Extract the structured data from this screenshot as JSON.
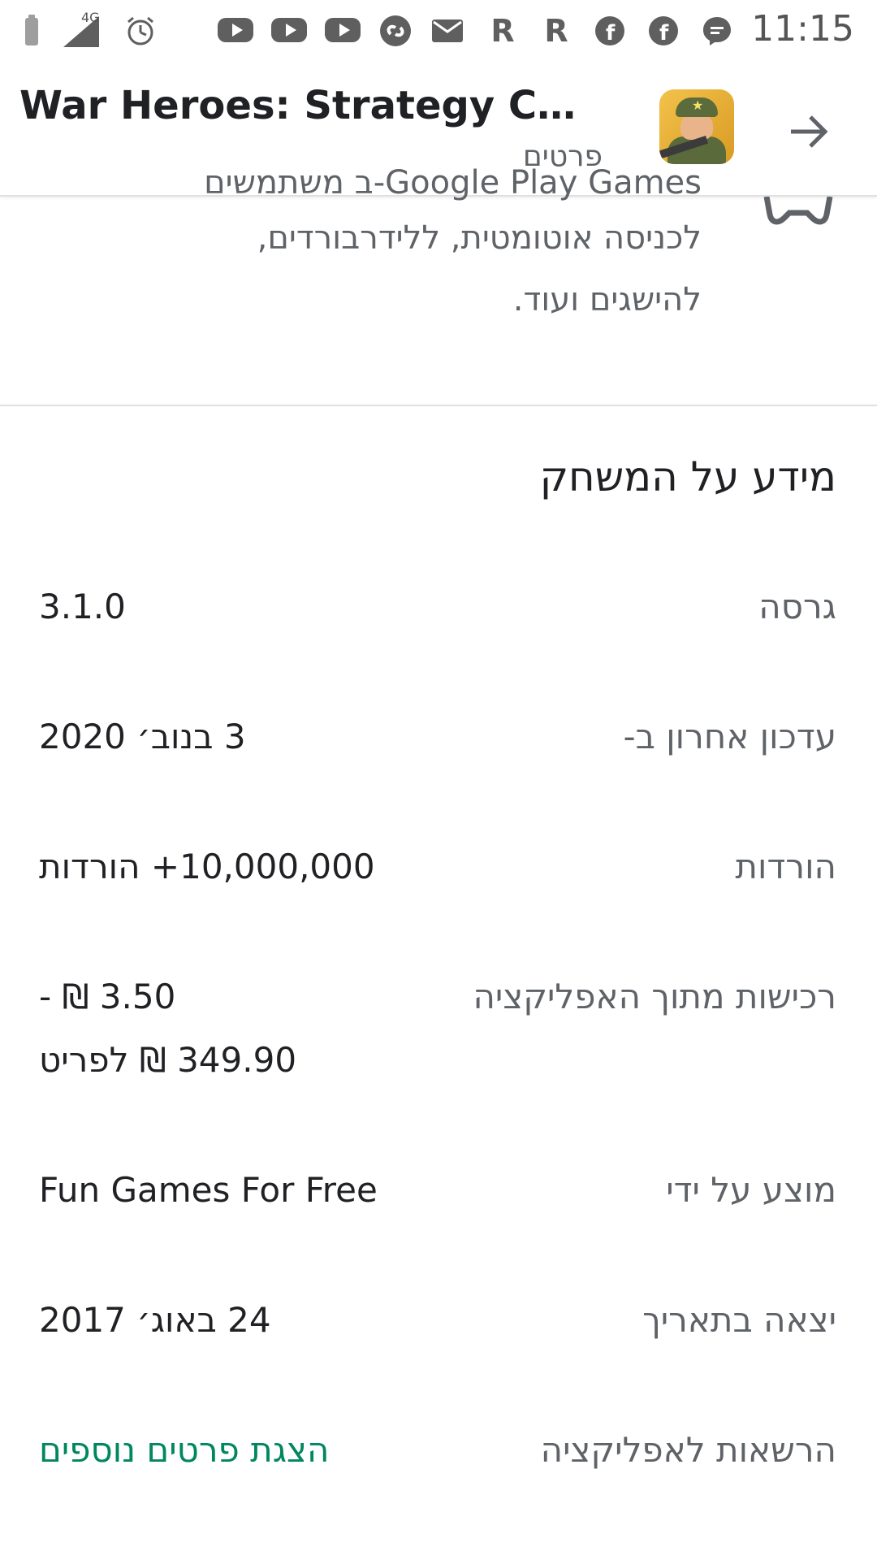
{
  "status_bar": {
    "network": "4G",
    "time": "11:15",
    "notification_icons": [
      "youtube-icon",
      "youtube-icon",
      "youtube-icon",
      "shazam-icon",
      "gmail-icon",
      "rakuten-icon",
      "rakuten-icon",
      "facebook-icon",
      "facebook-icon",
      "messenger-icon"
    ]
  },
  "header": {
    "title": "War Heroes: Strategy Car...",
    "subtitle": "פרטים"
  },
  "description": {
    "cut_line": "Google Play Games-ב משתמשים",
    "line1": "לכניסה אוטומטית, ללידרבורדים,",
    "line2": "להישגים ועוד."
  },
  "section": {
    "title": "מידע על המשחק"
  },
  "info_rows": [
    {
      "label": "גרסה",
      "value": "3.1.0"
    },
    {
      "label": "עדכון אחרון ב-",
      "value": "3 בנוב׳ 2020"
    },
    {
      "label": "הורדות",
      "value": "10,000,000+ הורדות"
    },
    {
      "label": "רכישות מתוך האפליקציה",
      "value_line1": "3.50 ₪ -",
      "value_line2": "349.90 ₪ לפריט"
    },
    {
      "label": "מוצע על ידי",
      "value": "Fun Games For Free"
    },
    {
      "label": "יצאה בתאריך",
      "value": "24 באוג׳ 2017"
    },
    {
      "label": "הרשאות לאפליקציה",
      "value": "הצגת פרטים נוספים"
    }
  ],
  "colors": {
    "link": "#01875f",
    "text_primary": "#202124",
    "text_secondary": "#5f6368"
  }
}
